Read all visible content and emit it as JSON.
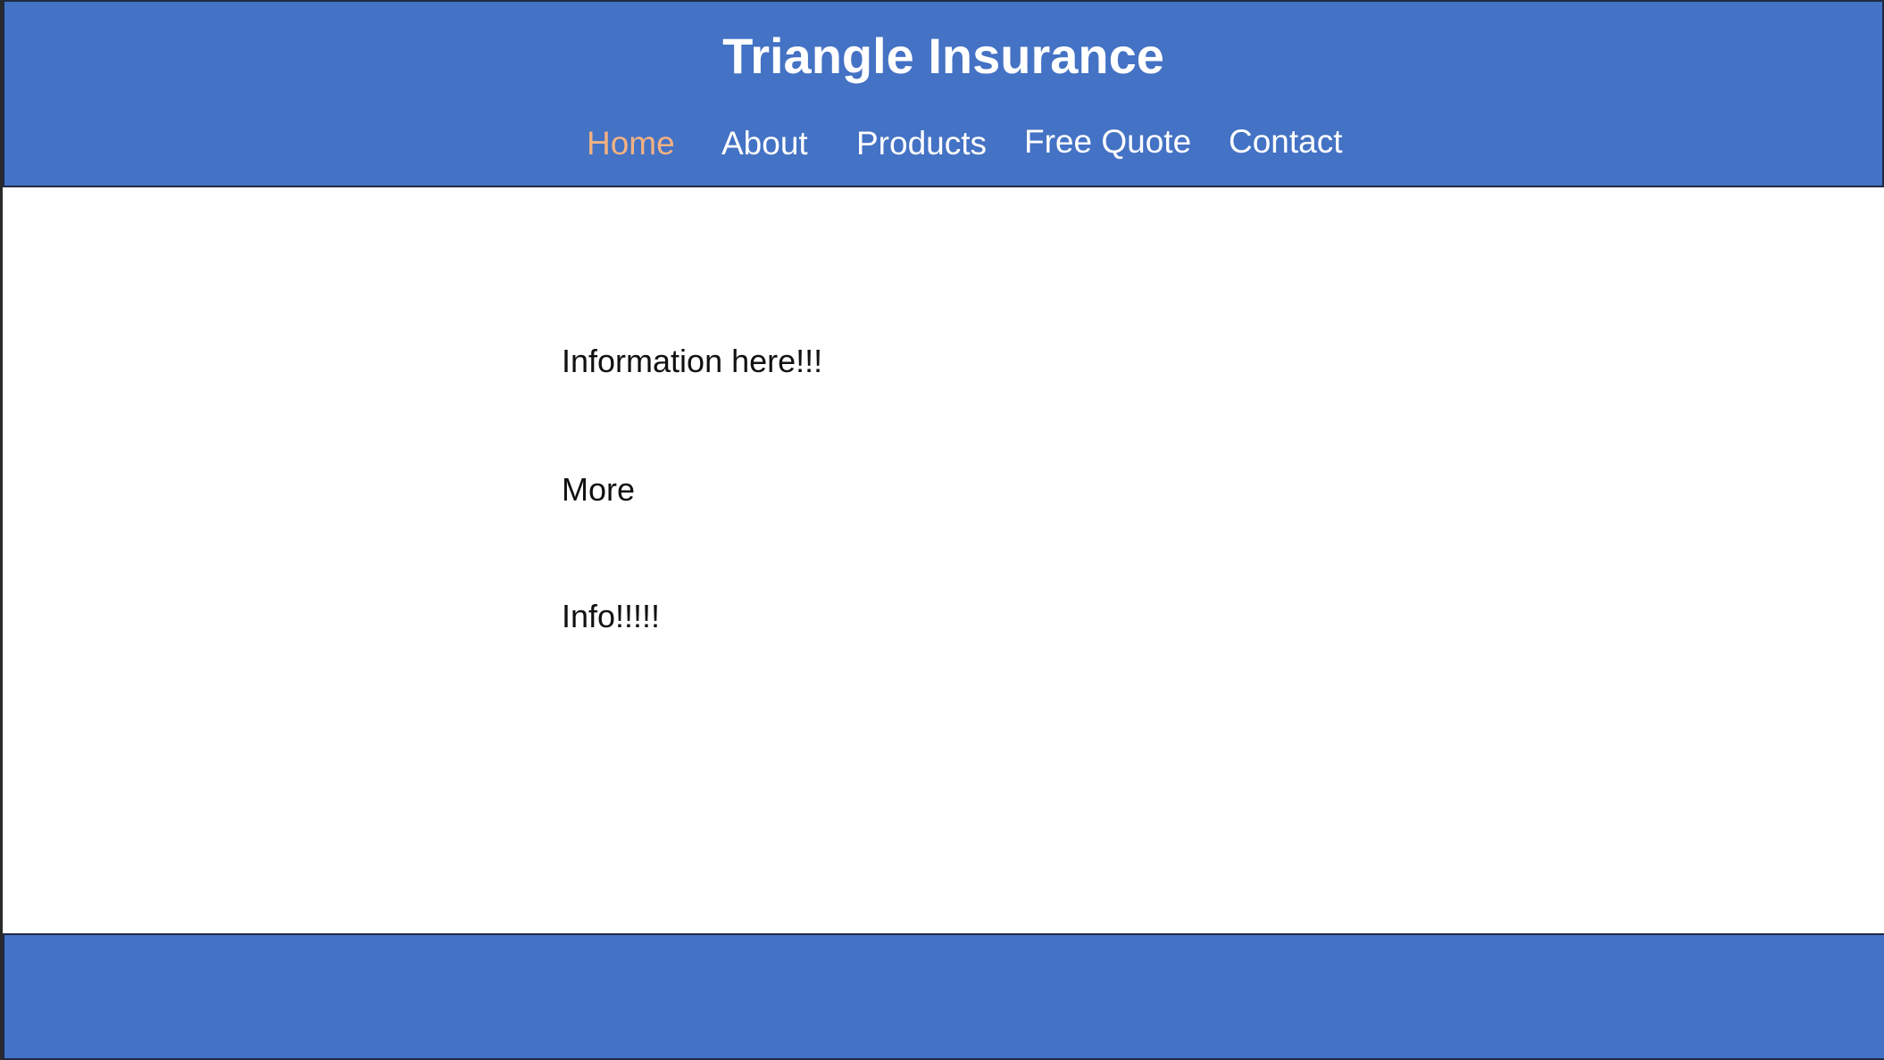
{
  "header": {
    "title": "Triangle Insurance",
    "nav": [
      {
        "label": "Home",
        "active": true
      },
      {
        "label": "About",
        "active": false
      },
      {
        "label": "Products",
        "active": false
      },
      {
        "label": "Free Quote",
        "active": false
      },
      {
        "label": "Contact",
        "active": false
      }
    ]
  },
  "main": {
    "paragraphs": [
      "Information here!!!",
      "More",
      "Info!!!!!"
    ]
  },
  "colors": {
    "header_background": "#4472c4",
    "footer_background": "#4472c4",
    "nav_active": "#f4b183",
    "nav_text": "#ffffff"
  }
}
